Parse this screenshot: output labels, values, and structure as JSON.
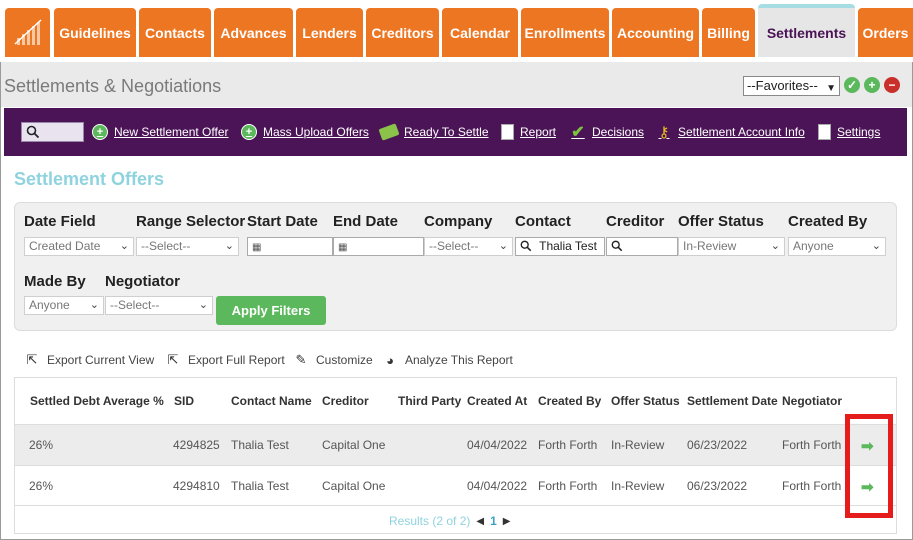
{
  "nav": {
    "tabs": [
      {
        "label": "Guidelines"
      },
      {
        "label": "Contacts"
      },
      {
        "label": "Advances"
      },
      {
        "label": "Lenders"
      },
      {
        "label": "Creditors"
      },
      {
        "label": "Calendar"
      },
      {
        "label": "Enrollments"
      },
      {
        "label": "Accounting"
      },
      {
        "label": "Billing"
      },
      {
        "label": "Settlements"
      },
      {
        "label": "Orders"
      }
    ],
    "active": "Settlements"
  },
  "header": {
    "title": "Settlements & Negotiations",
    "favorites_value": "--Favorites--"
  },
  "toolbar": {
    "items": [
      {
        "label": "New Settlement Offer",
        "icon": "plus-circle-icon"
      },
      {
        "label": "Mass Upload Offers",
        "icon": "plus-circle-icon"
      },
      {
        "label": "Ready To Settle",
        "icon": "money-icon"
      },
      {
        "label": "Report",
        "icon": "document-icon"
      },
      {
        "label": "Decisions",
        "icon": "check-icon"
      },
      {
        "label": "Settlement Account Info",
        "icon": "key-icon"
      },
      {
        "label": "Settings",
        "icon": "document-icon"
      }
    ]
  },
  "section": {
    "title": "Settlement Offers"
  },
  "filters": {
    "date_field": {
      "label": "Date Field",
      "value": "Created Date"
    },
    "range_selector": {
      "label": "Range Selector",
      "value": "--Select--"
    },
    "start_date": {
      "label": "Start Date",
      "value": ""
    },
    "end_date": {
      "label": "End Date",
      "value": ""
    },
    "company": {
      "label": "Company",
      "value": "--Select--"
    },
    "contact": {
      "label": "Contact",
      "value": "Thalia Test"
    },
    "creditor": {
      "label": "Creditor",
      "value": ""
    },
    "offer_status": {
      "label": "Offer Status",
      "value": "In-Review"
    },
    "created_by": {
      "label": "Created By",
      "value": "Anyone"
    },
    "made_by": {
      "label": "Made By",
      "value": "Anyone"
    },
    "negotiator": {
      "label": "Negotiator",
      "value": "--Select--"
    },
    "apply_label": "Apply Filters"
  },
  "actions": {
    "export_current": "Export Current View",
    "export_full": "Export Full Report",
    "customize": "Customize",
    "analyze": "Analyze This Report"
  },
  "table": {
    "columns": [
      "Settled Debt Average %",
      "SID",
      "Contact Name",
      "Creditor",
      "Third Party",
      "Created At",
      "Created By",
      "Offer Status",
      "Settlement Date",
      "Negotiator"
    ],
    "rows": [
      [
        "26%",
        "4294825",
        "Thalia Test",
        "Capital One",
        "",
        "04/04/2022",
        "Forth Forth",
        "In-Review",
        "06/23/2022",
        "Forth Forth"
      ],
      [
        "26%",
        "4294810",
        "Thalia Test",
        "Capital One",
        "",
        "04/04/2022",
        "Forth Forth",
        "In-Review",
        "06/23/2022",
        "Forth Forth"
      ]
    ],
    "results_text": "Results (2 of 2)",
    "page_number": "1"
  },
  "colors": {
    "nav_orange": "#ec7622",
    "toolbar_purple": "#4b1456",
    "section_teal": "#8fd3df",
    "apply_green": "#5cb85c",
    "highlight_red": "#e41c1c"
  }
}
